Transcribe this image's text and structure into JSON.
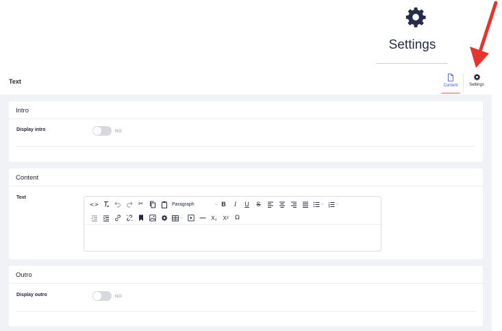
{
  "callout": {
    "label": "Settings",
    "icon": "gear-icon"
  },
  "header": {
    "title": "Text",
    "tabs": [
      {
        "label": "Content",
        "icon": "page-icon",
        "active": true
      },
      {
        "label": "Settings",
        "icon": "gear-icon",
        "active": false
      }
    ]
  },
  "intro": {
    "title": "Intro",
    "field_label": "Display intro",
    "toggle_text": "NO",
    "enabled": false
  },
  "content": {
    "title": "Content",
    "field_label": "Text",
    "format_select": "Paragraph",
    "toolbar_row1": [
      "code-icon",
      "clear-format-icon",
      "undo-icon",
      "redo-icon",
      "cut-icon",
      "copy-icon",
      "paste-icon",
      "format-select",
      "bold-icon",
      "italic-icon",
      "underline-icon",
      "strikethrough-icon",
      "align-left-icon",
      "align-center-icon",
      "align-right-icon",
      "align-justify-icon",
      "bullet-list-icon",
      "numbered-list-icon"
    ],
    "toolbar_row2": [
      "outdent-icon",
      "indent-icon",
      "link-icon",
      "unlink-icon",
      "bookmark-icon",
      "image-icon",
      "gear-icon",
      "table-icon",
      "media-icon",
      "horizontal-rule-icon",
      "subscript-icon",
      "superscript-icon",
      "omega-icon"
    ],
    "glyphs": {
      "bold": "B",
      "italic": "I",
      "underline": "U",
      "strike": "S",
      "subscript": "X₂",
      "superscript": "X²",
      "omega": "Ω",
      "code": "<>"
    }
  },
  "outro": {
    "title": "Outro",
    "field_label": "Display outro",
    "toggle_text": "NO",
    "enabled": false
  },
  "colors": {
    "accent_blue": "#3c5bd6",
    "tab_underline": "#f4a1a8",
    "arrow_red": "#e8332c",
    "canvas_bg": "#f1f2f5"
  }
}
